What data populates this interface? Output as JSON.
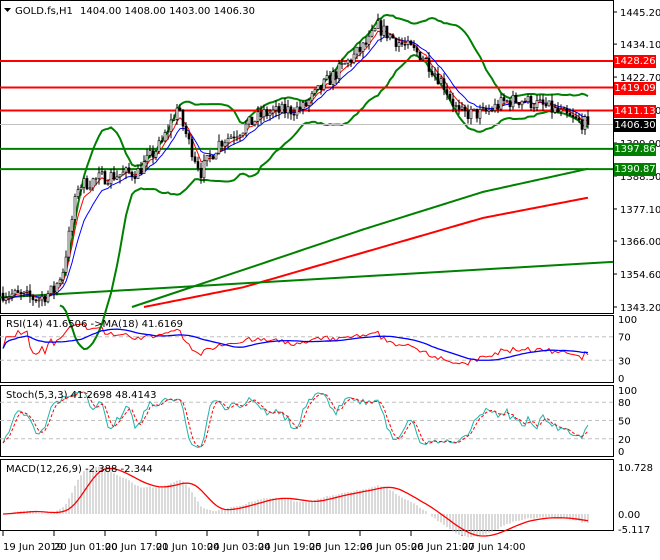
{
  "header": {
    "symbol": "GOLD.fs,H1",
    "ohlc": "1404.00 1408.00 1403.00 1406.30"
  },
  "chart_data": {
    "type": "candlestick",
    "title": "GOLD.fs,H1",
    "ylim": [
      1343.2,
      1445.2
    ],
    "y_ticks": [
      "1445.20",
      "1434.10",
      "1422.70",
      "1411.30",
      "1399.90",
      "1388.50",
      "1377.10",
      "1366.00",
      "1354.60",
      "1343.20"
    ],
    "x_ticks": [
      "19 Jun 2019",
      "20 Jun 01:00",
      "20 Jun 17:00",
      "21 Jun 10:00",
      "24 Jun 03:00",
      "24 Jun 19:00",
      "25 Jun 12:00",
      "26 Jun 05:00",
      "26 Jun 21:00",
      "27 Jun 14:00"
    ],
    "bars": 196,
    "close_path": [
      [
        0,
        1348
      ],
      [
        12,
        1346
      ],
      [
        17,
        1349
      ],
      [
        20,
        1356
      ],
      [
        25,
        1385
      ],
      [
        33,
        1388
      ],
      [
        45,
        1390
      ],
      [
        53,
        1400
      ],
      [
        58,
        1412
      ],
      [
        62,
        1400
      ],
      [
        66,
        1390
      ],
      [
        72,
        1400
      ],
      [
        80,
        1405
      ],
      [
        87,
        1410
      ],
      [
        100,
        1412
      ],
      [
        107,
        1420
      ],
      [
        115,
        1428
      ],
      [
        122,
        1435
      ],
      [
        125,
        1440
      ],
      [
        133,
        1434
      ],
      [
        140,
        1430
      ],
      [
        147,
        1420
      ],
      [
        152,
        1410
      ],
      [
        160,
        1410
      ],
      [
        167,
        1414
      ],
      [
        173,
        1415
      ],
      [
        182,
        1412
      ],
      [
        190,
        1408
      ],
      [
        195,
        1406.3
      ]
    ],
    "levels": [
      {
        "value": 1428.26,
        "label": "1428.26",
        "color": "#ff0000"
      },
      {
        "value": 1419.09,
        "label": "1419.09",
        "color": "#ff0000"
      },
      {
        "value": 1411.13,
        "label": "1411.13",
        "color": "#ff0000"
      },
      {
        "value": 1397.86,
        "label": "1397.86",
        "color": "#008000"
      },
      {
        "value": 1390.87,
        "label": "1390.87",
        "color": "#008000"
      }
    ],
    "current_price": {
      "value": 1406.3,
      "label": "1406.30"
    },
    "trendline": [
      [
        0,
        1346.5
      ],
      [
        204,
        1358.8
      ]
    ],
    "long_ma_green": [
      [
        43,
        1343.2
      ],
      [
        80,
        1356
      ],
      [
        120,
        1370
      ],
      [
        160,
        1383
      ],
      [
        195,
        1391
      ]
    ],
    "long_ma_red": [
      [
        47,
        1343.2
      ],
      [
        80,
        1350
      ],
      [
        120,
        1362
      ],
      [
        160,
        1374
      ],
      [
        195,
        1381
      ]
    ],
    "rsi": {
      "label": "RSI(14) 41.6506  ->MA(18) 41.6169",
      "ticks": [
        "100",
        "70",
        "30",
        "0"
      ]
    },
    "stoch": {
      "label": "Stoch(5,3,3) 41.2698 48.4143",
      "ticks": [
        "100",
        "80",
        "50",
        "20",
        "0"
      ]
    },
    "macd": {
      "label": "MACD(12,26,9) -2.388 -2.344",
      "ticks": [
        "10.728",
        "0.00",
        "-5.117"
      ]
    }
  },
  "colors": {
    "bull": "#ffffff",
    "bear": "#000000",
    "red": "#ff0000",
    "green": "#008000",
    "blue": "#0000ff",
    "teal": "#20b2aa"
  }
}
